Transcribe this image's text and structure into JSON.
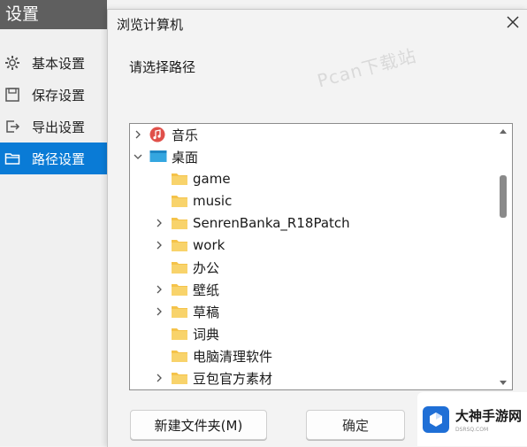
{
  "settings": {
    "title": "设置",
    "nav": [
      {
        "label": "基本设置",
        "icon": "gear-icon"
      },
      {
        "label": "保存设置",
        "icon": "save-icon"
      },
      {
        "label": "导出设置",
        "icon": "export-icon"
      },
      {
        "label": "路径设置",
        "icon": "folder-icon",
        "active": true
      }
    ]
  },
  "dialog": {
    "title": "浏览计算机",
    "prompt": "请选择路径",
    "watermark": "Pcan下载站",
    "tree": [
      {
        "label": "音乐",
        "level": 0,
        "chevron": "right",
        "icon": "music-icon"
      },
      {
        "label": "桌面",
        "level": 0,
        "chevron": "down",
        "icon": "desktop-icon",
        "selected": true
      },
      {
        "label": "game",
        "level": 1,
        "chevron": "none",
        "icon": "folder-icon"
      },
      {
        "label": "music",
        "level": 1,
        "chevron": "none",
        "icon": "folder-icon"
      },
      {
        "label": "SenrenBanka_R18Patch",
        "level": 1,
        "chevron": "right",
        "icon": "folder-icon"
      },
      {
        "label": "work",
        "level": 1,
        "chevron": "right",
        "icon": "folder-icon"
      },
      {
        "label": "办公",
        "level": 1,
        "chevron": "none",
        "icon": "folder-icon"
      },
      {
        "label": "壁纸",
        "level": 1,
        "chevron": "right",
        "icon": "folder-icon"
      },
      {
        "label": "草稿",
        "level": 1,
        "chevron": "right",
        "icon": "folder-icon"
      },
      {
        "label": "词典",
        "level": 1,
        "chevron": "none",
        "icon": "folder-icon"
      },
      {
        "label": "电脑清理软件",
        "level": 1,
        "chevron": "none",
        "icon": "folder-icon"
      },
      {
        "label": "豆包官方素材",
        "level": 1,
        "chevron": "right",
        "icon": "folder-icon"
      }
    ],
    "buttons": {
      "new_folder": "新建文件夹(M)",
      "ok": "确定"
    }
  },
  "corner_logo": {
    "name": "大神手游网",
    "domain": "DSRSQ.COM"
  },
  "colors": {
    "accent": "#0a7bd6",
    "folder": "#f5c34a",
    "titlebar": "#5f5f5f"
  }
}
